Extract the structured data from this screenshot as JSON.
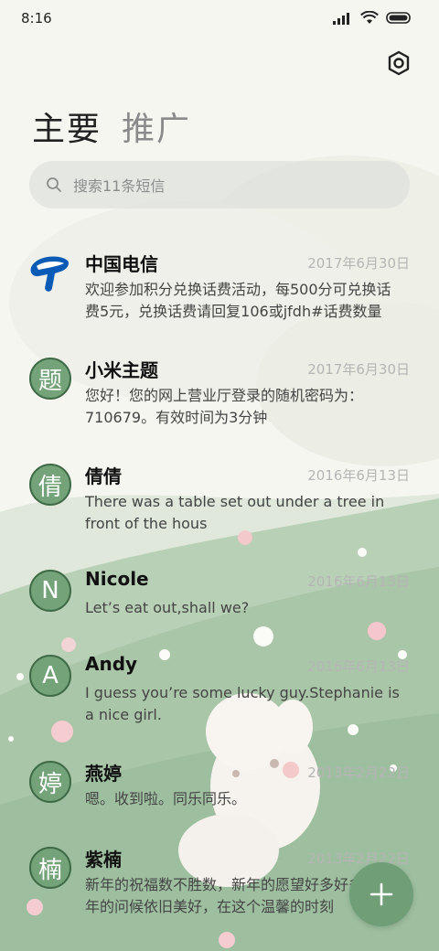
{
  "status_bar": {
    "time": "8:16"
  },
  "tabs": [
    {
      "label": "主要",
      "active": true
    },
    {
      "label": "推广",
      "active": false
    }
  ],
  "search": {
    "placeholder": "搜索11条短信"
  },
  "messages": [
    {
      "name": "中国电信",
      "avatar": "china-telecom-logo",
      "date": "2017年6月30日",
      "preview": "欢迎参加积分兑换话费活动，每500分可兑换话费5元，兑换话费请回复106或jfdh#话费数量"
    },
    {
      "name": "小米主题",
      "avatar": "题",
      "date": "2017年6月30日",
      "preview": "您好！您的网上营业厅登录的随机密码为：710679。有效时间为3分钟"
    },
    {
      "name": "倩倩",
      "avatar": "倩",
      "date": "2016年6月13日",
      "preview": "There was a table set out under a tree in front of the hous"
    },
    {
      "name": "Nicole",
      "avatar": "N",
      "date": "2016年6月13日",
      "preview": "Let’s eat out,shall we?"
    },
    {
      "name": "Andy",
      "avatar": "A",
      "date": "2016年6月13日",
      "preview": "I guess you’re some lucky guy.Stephanie is a nice girl."
    },
    {
      "name": "燕婷",
      "avatar": "婷",
      "date": "2013年2月22日",
      "preview": "嗯。收到啦。同乐同乐。"
    },
    {
      "name": "紫楠",
      "avatar": "楠",
      "date": "2013年2月22日",
      "preview": "新年的祝福数不胜数，新年的愿望好多好多，新年的问候依旧美好，在这个温馨的时刻"
    }
  ],
  "colors": {
    "accent": "#6f9e77",
    "avatar_bg": "#74a37a",
    "avatar_border": "#3f6a46",
    "telecom_blue": "#0a5bb5"
  },
  "icons": {
    "settings": "hexagon-gear-icon",
    "search": "search-icon",
    "fab": "plus-icon"
  }
}
